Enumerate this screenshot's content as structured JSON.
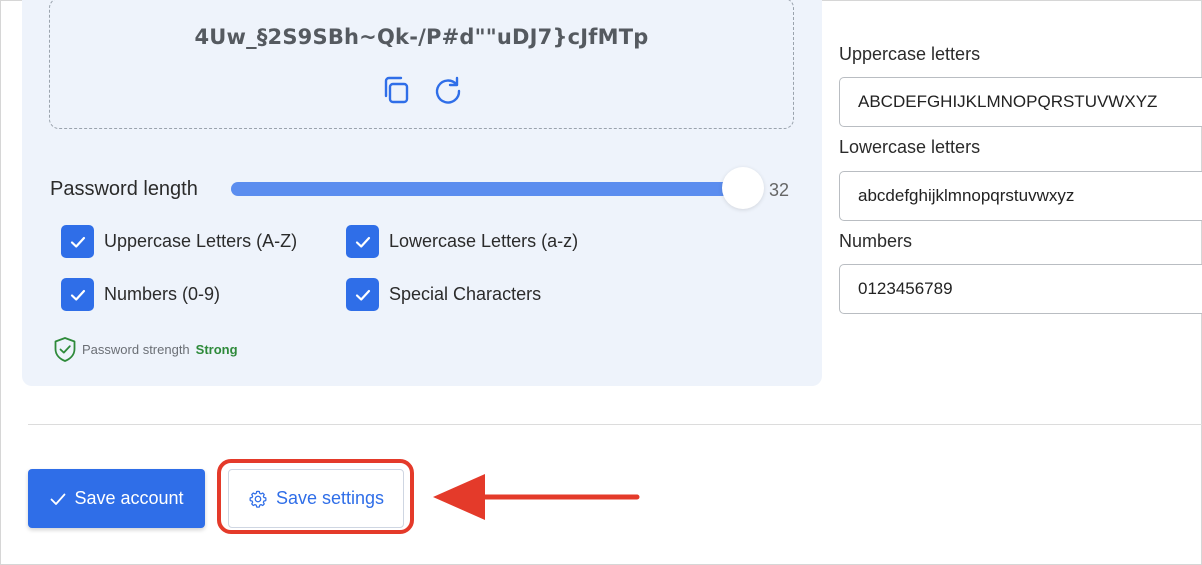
{
  "generator": {
    "password": "4Uw_§2S9SBh~Qk-/P#d\"\"uDJ7}cJfMTp",
    "length_label": "Password length",
    "length_value": "32",
    "options": [
      {
        "label": "Uppercase Letters (A-Z)",
        "checked": true
      },
      {
        "label": "Lowercase Letters (a-z)",
        "checked": true
      },
      {
        "label": "Numbers (0-9)",
        "checked": true
      },
      {
        "label": "Special Characters",
        "checked": true
      }
    ],
    "strength_label": "Password strength",
    "strength_value": "Strong"
  },
  "charsets": {
    "uppercase": {
      "label": "Uppercase letters",
      "value": "ABCDEFGHIJKLMNOPQRSTUVWXYZ"
    },
    "lowercase": {
      "label": "Lowercase letters",
      "value": "abcdefghijklmnopqrstuvwxyz"
    },
    "numbers": {
      "label": "Numbers",
      "value": "0123456789"
    }
  },
  "actions": {
    "save_account": "Save account",
    "save_settings": "Save settings"
  },
  "colors": {
    "accent": "#2f6ee8",
    "highlight": "#e43a2a",
    "strong": "#2e8a3a"
  }
}
